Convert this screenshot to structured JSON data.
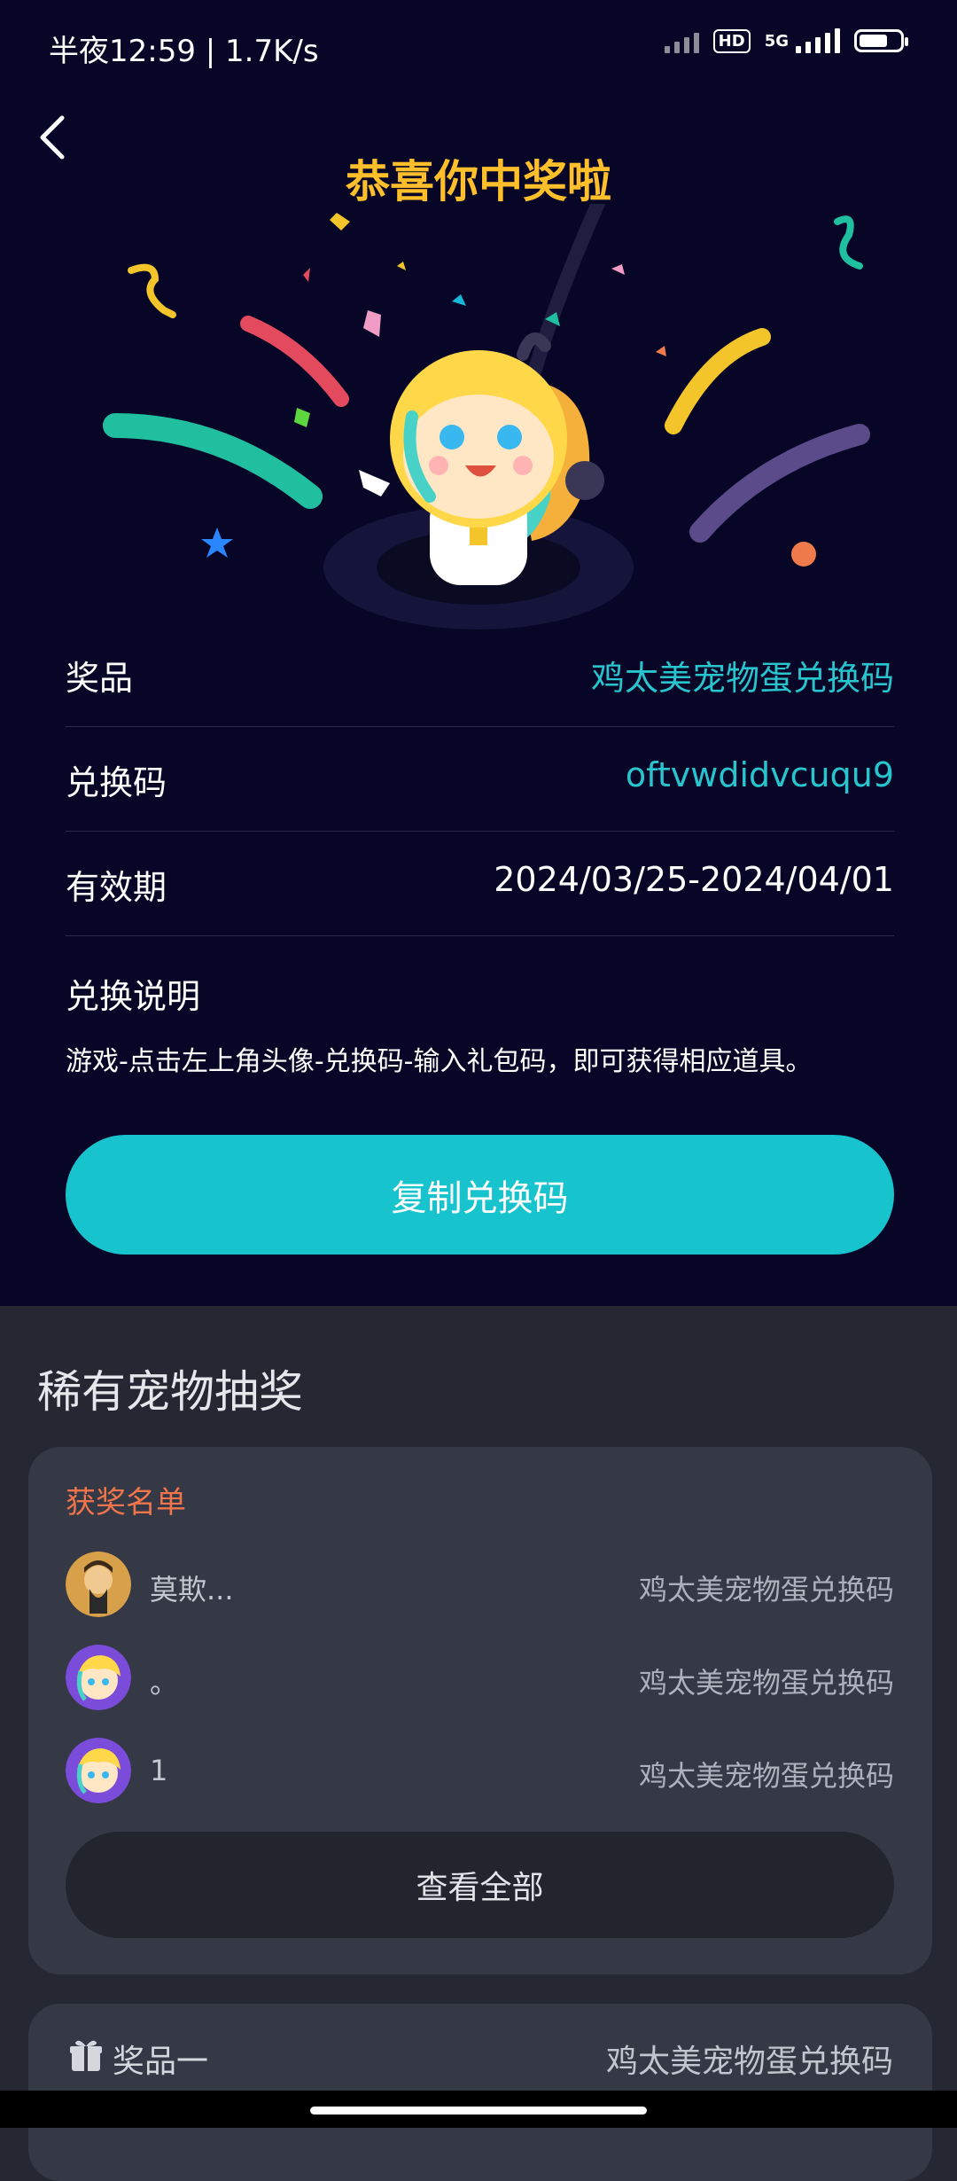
{
  "status_bar": {
    "time": "半夜12:59 | 1.7K/s",
    "hd": "HD",
    "network": "5G",
    "battery_level": 0.7
  },
  "header": {
    "back_icon": "chevron-left-icon",
    "title": "恭喜你中奖啦"
  },
  "prize_info": {
    "prize_label": "奖品",
    "prize_value": "鸡太美宠物蛋兑换码",
    "code_label": "兑换码",
    "code_value": "oftvwdidvcuqu9",
    "validity_label": "有效期",
    "validity_value": "2024/03/25-2024/04/01",
    "instructions_title": "兑换说明",
    "instructions_text": "游戏-点击左上角头像-兑换码-输入礼包码，即可获得相应道具。"
  },
  "copy_button": {
    "label": "复制兑换码"
  },
  "lottery": {
    "section_title": "稀有宠物抽奖",
    "winners_title": "获奖名单",
    "winners": [
      {
        "name": "莫欺...",
        "prize": "鸡太美宠物蛋兑换码"
      },
      {
        "name": "。",
        "prize": "鸡太美宠物蛋兑换码"
      },
      {
        "name": "1",
        "prize": "鸡太美宠物蛋兑换码"
      }
    ],
    "view_all_label": "查看全部"
  },
  "prize_item": {
    "icon": "gift-icon",
    "name": "奖品一",
    "prize": "鸡太美宠物蛋兑换码"
  },
  "colors": {
    "accent_cyan": "#17c3cd",
    "title_gold": "#ffbf2b",
    "winners_orange": "#f0754c",
    "top_bg": "#070626"
  }
}
